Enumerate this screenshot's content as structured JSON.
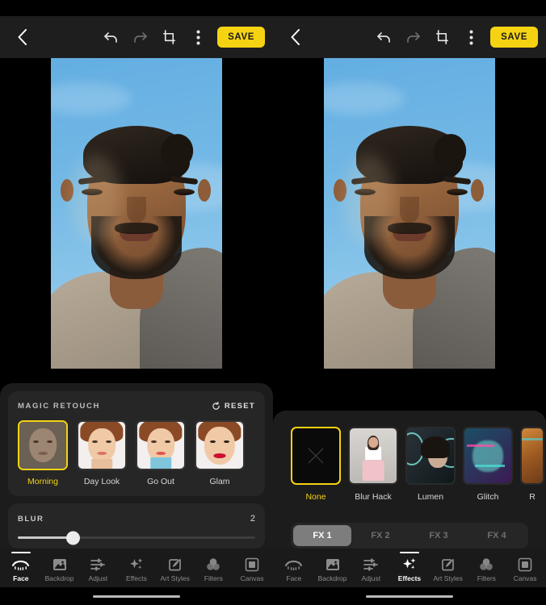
{
  "app": {
    "accent_yellow": "#f5d313",
    "background": "#000000",
    "panel_bg": "#1c1c1c",
    "card_bg": "#262626"
  },
  "toolbar": {
    "back_icon": "chevron-left-icon",
    "undo_icon": "undo-arrow-icon",
    "redo_icon": "redo-arrow-icon",
    "crop_icon": "crop-rotate-icon",
    "more_icon": "more-vertical-icon",
    "save_label": "SAVE"
  },
  "left_panel": {
    "retouch": {
      "title": "MAGIC RETOUCH",
      "reset_label": "RESET",
      "reset_icon": "refresh-icon",
      "presets": [
        {
          "label": "Morning",
          "selected": true
        },
        {
          "label": "Day Look",
          "selected": false
        },
        {
          "label": "Go Out",
          "selected": false
        },
        {
          "label": "Glam",
          "selected": false
        }
      ]
    },
    "slider": {
      "name": "BLUR",
      "value": "2",
      "percent": 23
    },
    "nav": {
      "items": [
        {
          "label": "Face",
          "icon": "eye-lashes-icon",
          "selected": true
        },
        {
          "label": "Backdrop",
          "icon": "image-icon",
          "selected": false
        },
        {
          "label": "Adjust",
          "icon": "sliders-icon",
          "selected": false
        },
        {
          "label": "Effects",
          "icon": "sparkles-icon",
          "selected": false
        },
        {
          "label": "Art Styles",
          "icon": "brush-square-icon",
          "selected": false
        },
        {
          "label": "Filters",
          "icon": "color-circles-icon",
          "selected": false
        },
        {
          "label": "Canvas",
          "icon": "square-frame-icon",
          "selected": false
        }
      ]
    }
  },
  "right_panel": {
    "effects": [
      {
        "label": "None",
        "selected": true,
        "style": "none"
      },
      {
        "label": "Blur Hack",
        "selected": false,
        "style": "a"
      },
      {
        "label": "Lumen",
        "selected": false,
        "style": "b"
      },
      {
        "label": "Glitch",
        "selected": false,
        "style": "c"
      },
      {
        "label": "R",
        "selected": false,
        "style": "d",
        "clipped": true
      }
    ],
    "fx_tabs": [
      {
        "label": "FX 1",
        "selected": true
      },
      {
        "label": "FX 2",
        "selected": false
      },
      {
        "label": "FX 3",
        "selected": false
      },
      {
        "label": "FX 4",
        "selected": false
      }
    ],
    "nav": {
      "items": [
        {
          "label": "Face",
          "icon": "eye-lashes-icon",
          "selected": false
        },
        {
          "label": "Backdrop",
          "icon": "image-icon",
          "selected": false
        },
        {
          "label": "Adjust",
          "icon": "sliders-icon",
          "selected": false
        },
        {
          "label": "Effects",
          "icon": "sparkles-icon",
          "selected": true
        },
        {
          "label": "Art Styles",
          "icon": "brush-square-icon",
          "selected": false
        },
        {
          "label": "Filters",
          "icon": "color-circles-icon",
          "selected": false
        },
        {
          "label": "Canvas",
          "icon": "square-frame-icon",
          "selected": false
        }
      ]
    }
  },
  "photo": {
    "description": "selfie-portrait-blue-sky"
  }
}
